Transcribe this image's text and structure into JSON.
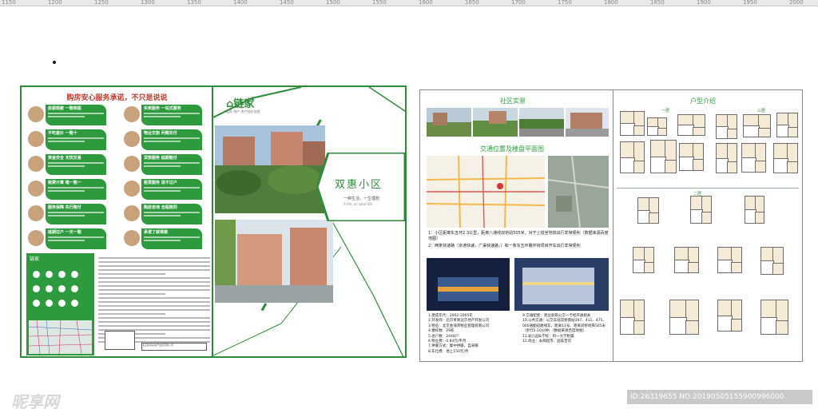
{
  "ruler": {
    "ticks": [
      "1150",
      "1200",
      "1250",
      "1300",
      "1350",
      "1400",
      "1450",
      "1500",
      "1550",
      "1600",
      "1650",
      "1700",
      "1750",
      "1800",
      "1850",
      "1900",
      "1950",
      "2000"
    ]
  },
  "panel1": {
    "title": "购房安心服务承诺，不只是说说",
    "services_left": [
      "房屋瑕疵 一赔到底",
      "不吃差价 一赔十",
      "资金安全 无忧交易",
      "税费计算 错一赔一",
      "服务保障 先行赔付",
      "延期过户 一天一赔"
    ],
    "services_right": [
      "买卖服务 一站式服务",
      "物业交割 问题先付",
      "贷款服务 延期赔付",
      "租赁服务 退不过户",
      "购房咨询 全程陪同",
      "承诺了就得做"
    ],
    "logo": "链家",
    "seal_text": "北京链家房地产经纪有限公司"
  },
  "panel2": {
    "logo": "链家",
    "logo_sub": "链家 地产 房产经纪连锁",
    "title": "双惠小区",
    "slogan": "一种生活，一生理想",
    "slogan_en": "A life, an ideal life"
  },
  "panel3": {
    "section1": "社区实景",
    "section2": "交通位置及楼盘平面图",
    "traffic": "1：小区距离东五环2.3公里，距离八通线双桥站505米，对于上班坐地铁出行非常便利（数据来源百度地图）",
    "traffic2": "2：两条快速路（京通快速，广渠快速路，）和一条东五环路环绕项目开车出行非常便利",
    "info_left": [
      "1.建成年代：2002-2005年",
      "2.开发商：北京青果远京地产开发公司",
      "3.物业：北京金海邦物业管理有限公司",
      "4.楼栋数：29栋",
      "5.总户数：2448户",
      "6.物业费：0.84元/平月",
      "7.供暖方式：集中供暖，自采暖",
      "8.车位费：地上150元/月"
    ],
    "info_right": [
      "9.交通配套：周边高铁公交一卡经开通相关",
      "10.公共交通：公交车站双桥南站397、411、475、000通勤班路线车，距离11号、距离双桥地铁505米（步行5-10分钟）（数据来源百度地图）",
      "11.幼儿园&学校：阿一大学附属",
      "12.商业：永辉超市、国美百货"
    ]
  },
  "panel4": {
    "title": "户型介绍",
    "group1": "一居",
    "group2": "二居",
    "group3": "三居"
  },
  "watermark": {
    "left": "昵享网",
    "right": "ID:26319655 NO:20190505155900996000"
  },
  "colors": {
    "brand": "#2e8b3a",
    "accent_red": "#c0392b",
    "bolt": "#6f7fc0"
  }
}
